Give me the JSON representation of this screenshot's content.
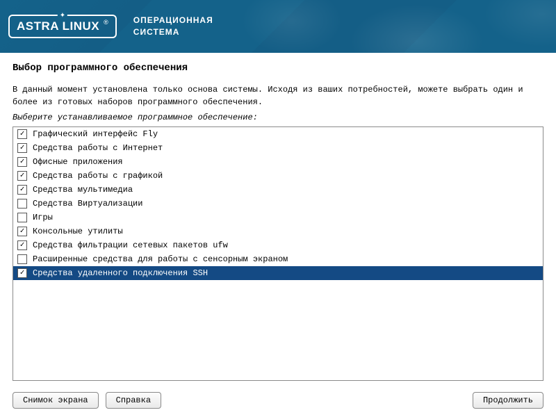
{
  "header": {
    "brand": "ASTRA LINUX",
    "reg": "®",
    "subtitle_line1": "ОПЕРАЦИОННАЯ",
    "subtitle_line2": "СИСТЕМА"
  },
  "page": {
    "title": "Выбор программного обеспечения",
    "description": "В данный момент установлена только основа системы. Исходя из ваших потребностей, можете выбрать один и более из готовых наборов программного обеспечения.",
    "instruction": "Выберите устанавливаемое программное обеспечение:"
  },
  "software_items": [
    {
      "label": "Графический интерфейс Fly",
      "checked": true,
      "selected": false
    },
    {
      "label": "Средства работы с Интернет",
      "checked": true,
      "selected": false
    },
    {
      "label": "Офисные приложения",
      "checked": true,
      "selected": false
    },
    {
      "label": "Средства работы с графикой",
      "checked": true,
      "selected": false
    },
    {
      "label": "Средства мультимедиа",
      "checked": true,
      "selected": false
    },
    {
      "label": "Средства Виртуализации",
      "checked": false,
      "selected": false
    },
    {
      "label": "Игры",
      "checked": false,
      "selected": false
    },
    {
      "label": "Консольные утилиты",
      "checked": true,
      "selected": false
    },
    {
      "label": "Средства фильтрации сетевых пакетов ufw",
      "checked": true,
      "selected": false
    },
    {
      "label": "Расширенные средства для работы с сенсорным экраном",
      "checked": false,
      "selected": false
    },
    {
      "label": "Средства удаленного подключения SSH",
      "checked": true,
      "selected": true
    }
  ],
  "buttons": {
    "screenshot": "Снимок экрана",
    "help": "Справка",
    "continue": "Продолжить"
  },
  "glyphs": {
    "check": "✓",
    "star": "✦"
  }
}
